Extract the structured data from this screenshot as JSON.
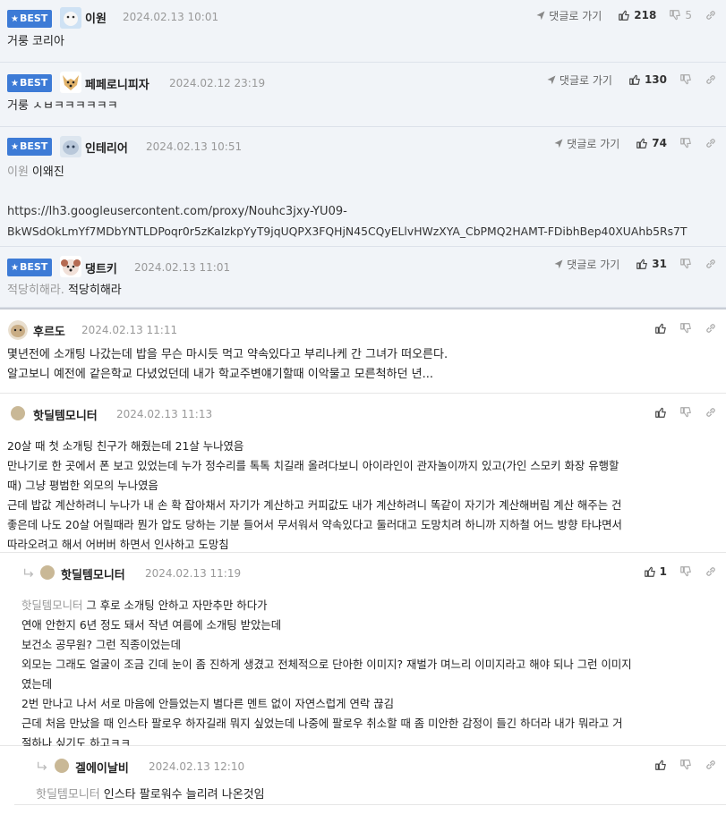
{
  "labels": {
    "best": "BEST",
    "goto": "댓글로 가기"
  },
  "comments": [
    {
      "nick": "이원",
      "date": "2024.02.13 10:01",
      "likes": "218",
      "dislikes": "5",
      "text": "거룽 코리아"
    },
    {
      "nick": "페페로니피자",
      "date": "2024.02.12 23:19",
      "likes": "130",
      "text": "거룽 ㅅㅂㅋㅋㅋㅋㅋㅋ"
    },
    {
      "nick": "인테리어",
      "date": "2024.02.13 10:51",
      "likes": "74",
      "mention": "이원",
      "text": "이왜진",
      "link1": "https://lh3.googleusercontent.com/proxy/Nouhc3jxy-YU09-",
      "link2": "BkWSdOkLmYf7MDbYNTLDPoqr0r5zKaIzkpYyT9jqUQPX3FQHjN45CQyELlvHWzXYA_CbPMQ2HAMT-FDibhBep40XUAhb5Rs7T"
    },
    {
      "nick": "댕트키",
      "date": "2024.02.13 11:01",
      "likes": "31",
      "mention": "적당히해라.",
      "text": "적당히해라"
    },
    {
      "nick": "후르도",
      "date": "2024.02.13 11:11",
      "lines": [
        "몇년전에 소개팅 나갔는데 밥을 무슨 마시듯 먹고 약속있다고 부리나케 간 그녀가 떠오른다.",
        "알고보니 예전에 같은학교 다녔었던데 내가 학교주변얘기할때 이악물고 모른척하던 년..."
      ]
    },
    {
      "nick": "핫딜템모니터",
      "date": "2024.02.13 11:13",
      "lines": [
        "20살 때 첫 소개팅 친구가 해줬는데 21살 누나였음",
        "만나기로 한 곳에서 폰 보고 있었는데 누가 정수리를 톡톡 치길래 올려다보니 아이라인이 관자놀이까지 있고(가인 스모키 화장 유행할",
        "때) 그냥 평범한 외모의 누나였음",
        "근데 밥값 계산하려니 누나가 내 손 확 잡아채서 자기가 계산하고 커피값도 내가 계산하려니 똑같이 자기가 계산해버림 계산 해주는 건",
        "좋은데 나도 20살 어릴때라 뭔가 압도 당하는 기분 들어서 무서워서 약속있다고 둘러대고 도망치려 하니까 지하철 어느 방향 타냐면서",
        "따라오려고 해서 어버버 하면서 인사하고 도망침"
      ]
    },
    {
      "nick": "핫딜템모니터",
      "date": "2024.02.13 11:19",
      "likes": "1",
      "mention": "핫딜템모니터",
      "first": "그 후로 소개팅 안하고 자만추만 하다가",
      "lines": [
        "연애 안한지 6년 정도 돼서 작년 여름에 소개팅 받았는데",
        "보건소 공무원? 그런 직종이었는데",
        "외모는 그래도 얼굴이 조금 긴데 눈이 좀 진하게 생겼고 전체적으로 단아한 이미지? 재벌가 며느리 이미지라고 해야 되나 그런 이미지",
        "였는데",
        "2번 만나고 나서 서로 마음에 안들었는지 별다른 멘트 없이 자연스럽게 연락 끊김",
        "근데 처음 만났을 때 인스타 팔로우 하자길래 뭐지 싶었는데 나중에 팔로우 취소할 때 좀 미안한 감정이 들긴 하더라 내가 뭐라고 거",
        "절하나 싶기도 하고ㅋㅋ"
      ]
    },
    {
      "nick": "겔에이날비",
      "date": "2024.02.13 12:10",
      "mention": "핫딜템모니터",
      "text": "인스타 팔로워수 늘리려 나온것임"
    }
  ],
  "colors": {
    "badge": "#3d7bd6",
    "bestBg": "#f1f4f8"
  }
}
